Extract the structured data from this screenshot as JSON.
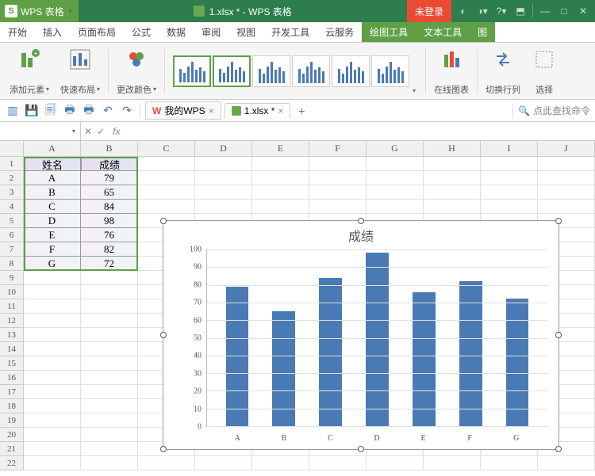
{
  "app": {
    "name": "WPS 表格",
    "doc_title": "1.xlsx * - WPS 表格",
    "login_badge": "未登录"
  },
  "menu": {
    "tabs": [
      "开始",
      "插入",
      "页面布局",
      "公式",
      "数据",
      "审阅",
      "视图",
      "开发工具",
      "云服务",
      "绘图工具",
      "文本工具",
      "图"
    ],
    "active_index": 9
  },
  "ribbon": {
    "add_element": "添加元素",
    "quick_layout": "快速布局",
    "change_color": "更改颜色",
    "online_chart": "在线图表",
    "switch_rowcol": "切换行列",
    "select": "选择"
  },
  "doc_tabs": {
    "mywps": "我的WPS",
    "file": "1.xlsx *",
    "search_placeholder": "点此查找命令"
  },
  "formula_bar": {
    "namebox": "",
    "fx": "fx"
  },
  "grid": {
    "cols": [
      "A",
      "B",
      "C",
      "D",
      "E",
      "F",
      "G",
      "H",
      "I",
      "J"
    ],
    "row_count": 22,
    "headers": [
      "姓名",
      "成绩"
    ],
    "rows": [
      [
        "A",
        "79"
      ],
      [
        "B",
        "65"
      ],
      [
        "C",
        "84"
      ],
      [
        "D",
        "98"
      ],
      [
        "E",
        "76"
      ],
      [
        "F",
        "82"
      ],
      [
        "G",
        "72"
      ]
    ]
  },
  "chart_data": {
    "type": "bar",
    "title": "成绩",
    "categories": [
      "A",
      "B",
      "C",
      "D",
      "E",
      "F",
      "G"
    ],
    "values": [
      79,
      65,
      84,
      98,
      76,
      82,
      72
    ],
    "xlabel": "",
    "ylabel": "",
    "ylim": [
      0,
      100
    ],
    "yticks": [
      0,
      10,
      20,
      30,
      40,
      50,
      60,
      70,
      80,
      90,
      100
    ]
  }
}
